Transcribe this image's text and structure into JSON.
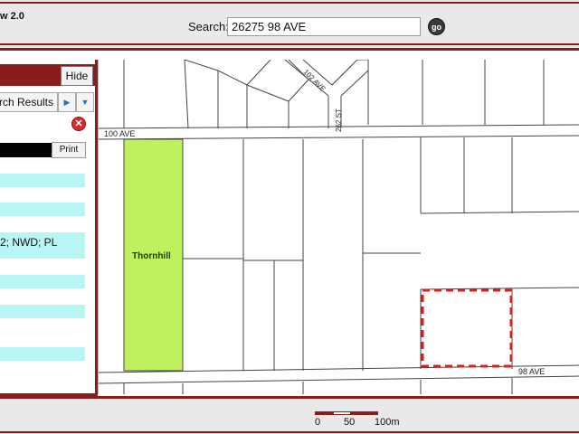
{
  "header": {
    "app_title": "w 2.0",
    "search_label": "Search:",
    "search_value": "26275 98 AVE",
    "go_label": "go"
  },
  "panel": {
    "hide_label": "Hide",
    "results_tab_label": "rch Results",
    "print_label": "Print",
    "result_snippet": "2; NWD; PL"
  },
  "map": {
    "street_labels": {
      "ave100": "100 AVE",
      "ave98": "98 AVE",
      "ave102": "102 AVE",
      "st262": "262 ST"
    },
    "parcel_label": "Thornhill",
    "highlight_color": "#bff060",
    "selection_color": "#d61f1f"
  },
  "footer": {
    "scale_labels": [
      "0",
      "50",
      "100m"
    ]
  },
  "colors": {
    "accent": "#8b1c1c",
    "result_row": "#b8f6f6"
  }
}
